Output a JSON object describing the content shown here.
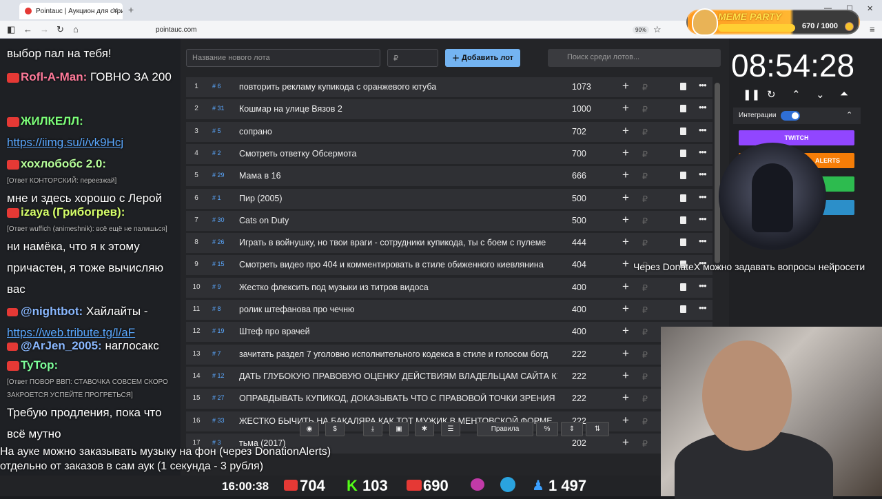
{
  "browser": {
    "tab_title": "Pointauc | Аукцион для стримеров",
    "url": "pointauc.com",
    "zoom": "90%"
  },
  "meme_party": {
    "title": "MEME PARTY",
    "count": "670 / 1000"
  },
  "chat": [
    {
      "text": "выбор пал на тебя!"
    },
    {
      "nick": "Rofl-A-Man:",
      "text": "ГОВНО ЗА 200"
    },
    {
      "nick": "ЖИЛКЕЛЛ:",
      "link": "https://iimg.su/i/vk9Hcj"
    },
    {
      "nick": "хохлобобс 2.0:",
      "reply": "[Ответ КОНТОРСКИЙ: переезжай]",
      "text": "мне и здесь хорошо с Лерой"
    },
    {
      "nick": "izaya (Грибогрев):",
      "reply": "[Ответ wuffich (animeshnik): всё ещё не палишься]",
      "text": "ни намёка, что я к этому причастен, я тоже вычисляю вас"
    },
    {
      "nick": "@nightbot:",
      "text": "Хайлайты -",
      "link": "https://web.tribute.tg/l/aF"
    },
    {
      "nick": "@ArJen_2005:",
      "text": "наглосакс"
    },
    {
      "nick": "TyTop:",
      "reply": "[Ответ ПОВОР ВВП: СТАВОЧКА СОВСЕМ СКОРО ЗАКРОЕТСЯ УСПЕЙТЕ ПРОГРЕТЬСЯ]",
      "text": "Требую продления, пока что всё мутно"
    }
  ],
  "auction": {
    "new_lot_placeholder": "Название нового лота",
    "amount_placeholder": "₽",
    "add_button": "Добавить лот",
    "search_placeholder": "Поиск среди лотов...",
    "currency": "₽",
    "lots": [
      {
        "n": "1",
        "id": "# 6",
        "name": "повторить рекламу купикода с оранжевого ютуба",
        "amount": "1073"
      },
      {
        "n": "2",
        "id": "# 31",
        "name": "Кошмар на улице Вязов 2",
        "amount": "1000"
      },
      {
        "n": "3",
        "id": "# 5",
        "name": "сопрано",
        "amount": "702"
      },
      {
        "n": "4",
        "id": "# 2",
        "name": "Смотреть ответку Обсермота",
        "amount": "700"
      },
      {
        "n": "5",
        "id": "# 29",
        "name": "Мама в 16",
        "amount": "666"
      },
      {
        "n": "6",
        "id": "# 1",
        "name": "Пир (2005)",
        "amount": "500"
      },
      {
        "n": "7",
        "id": "# 30",
        "name": "Cats on Duty",
        "amount": "500"
      },
      {
        "n": "8",
        "id": "# 26",
        "name": "Играть в войнушку, но твои враги - сотрудники купикода, ты с боем с пулеме",
        "amount": "444"
      },
      {
        "n": "9",
        "id": "# 15",
        "name": "Смотреть видео про 404 и комментировать в стиле обиженного киевлянина",
        "amount": "404"
      },
      {
        "n": "10",
        "id": "# 9",
        "name": "Жестко флексить под музыки из титров видоса",
        "amount": "400"
      },
      {
        "n": "11",
        "id": "# 8",
        "name": " ролик штефанова про чечню",
        "amount": "400"
      },
      {
        "n": "12",
        "id": "# 19",
        "name": "Штеф про врачей",
        "amount": "400"
      },
      {
        "n": "13",
        "id": "# 7",
        "name": "зачитать раздел 7 уголовно исполнительного кодекса в стиле и голосом богд",
        "amount": "222"
      },
      {
        "n": "14",
        "id": "# 12",
        "name": "ДАТЬ ГЛУБОКУЮ ПРАВОВУЮ ОЦЕНКУ ДЕЙСТВИЯМ ВЛАДЕЛЬЦАМ САЙТА КУ",
        "amount": "222"
      },
      {
        "n": "15",
        "id": "# 27",
        "name": "ОПРАВДЫВАТЬ КУПИКОД, ДОКАЗЫВАТЬ ЧТО С ПРАВОВОЙ ТОЧКИ ЗРЕНИЯ С",
        "amount": "222"
      },
      {
        "n": "16",
        "id": "# 33",
        "name": "ЖЕСТКО БЫЧИТЬ НА БАКАЛЯРА КАК ТОТ МУЖИК В МЕНТОВСКОЙ ФОРМЕ. З",
        "amount": "222"
      },
      {
        "n": "17",
        "id": "# 3",
        "name": "тьма (2017)",
        "amount": "202"
      }
    ],
    "rules_button": "Правила"
  },
  "timer": "08:54:28",
  "integrations": {
    "label": "Интеграции",
    "twitch": "TWITCH",
    "alerts": "ALERTS"
  },
  "ticker": "Через DonateX можно задавать вопросы нейросети",
  "bottom_text": [
    "На ауке можно заказывать музыку на фон (через DonationAlerts)",
    "отдельно от заказов в сам аук (1 секунда - 3 рубля)"
  ],
  "stream_stats": {
    "time": "16:00:38",
    "youtube": "704",
    "kick": "103",
    "live": "690",
    "viewers": "1 497"
  }
}
